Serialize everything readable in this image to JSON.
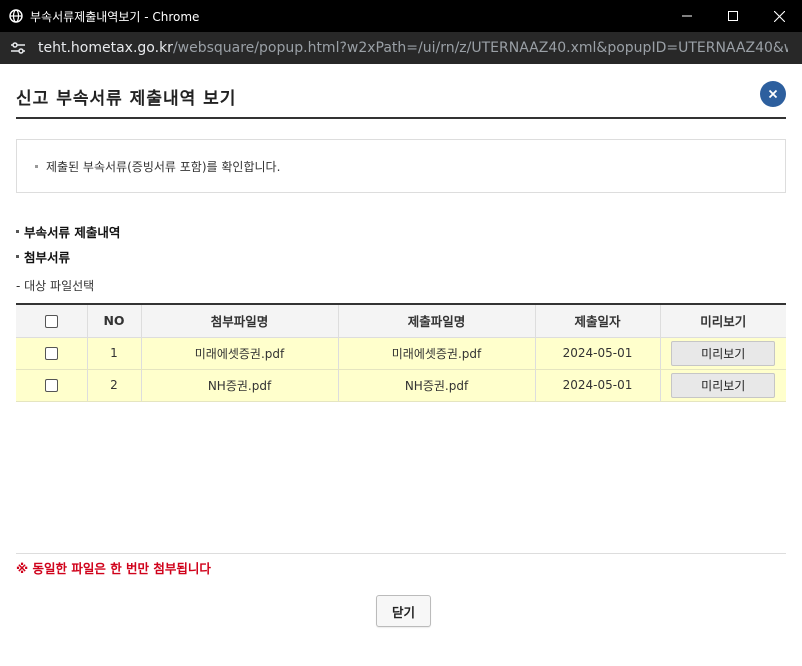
{
  "window": {
    "title": "부속서류제출내역보기 - Chrome",
    "url_host": "teht.hometax.go.kr",
    "url_path": "/websquare/popup.html?w2xPath=/ui/rn/z/UTERNAAZ40.xml&popupID=UTERNAAZ40&w2xHom..."
  },
  "popup": {
    "title": "신고 부속서류 제출내역 보기",
    "info_text": "제출된 부속서류(증빙서류 포함)를 확인합니다.",
    "section1": "부속서류 제출내역",
    "section2": "첨부서류",
    "sub_label": "- 대상 파일선택"
  },
  "table": {
    "headers": [
      "NO",
      "첨부파일명",
      "제출파일명",
      "제출일자",
      "미리보기"
    ],
    "rows": [
      {
        "no": "1",
        "attach": "미래에셋증권.pdf",
        "submit": "미래에셋증권.pdf",
        "date": "2024-05-01",
        "preview": "미리보기"
      },
      {
        "no": "2",
        "attach": "NH증권.pdf",
        "submit": "NH증권.pdf",
        "date": "2024-05-01",
        "preview": "미리보기"
      }
    ]
  },
  "footer": {
    "warning": "※ 동일한 파일은 한 번만 첨부됩니다",
    "close_label": "닫기"
  },
  "colors": {
    "accent": "#2d5f9e",
    "row_highlight": "#ffffcc",
    "warning": "#d0021b"
  }
}
